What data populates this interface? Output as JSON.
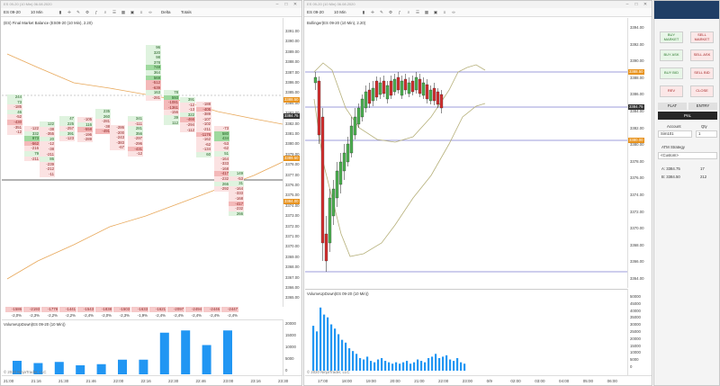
{
  "left_window": {
    "title": "ES 09-20 (10 Min)   06.08.2020",
    "instrument": "ES 09-20",
    "period": "10 Min",
    "toolbar_delta": "Delta",
    "toolbar_totals": "Totals",
    "indicator_label": "(ES09-20 (10 Min), 2.20)",
    "indicator_prefix": "(ES) Final Market Balance",
    "price_axis": [
      "3391.00",
      "3390.00",
      "3389.00",
      "3388.00",
      "3387.00",
      "3386.00",
      "3385.00",
      "3384.00",
      "3383.00",
      "3382.00",
      "3381.00",
      "3380.00",
      "3379.00",
      "3378.00",
      "3377.00",
      "3376.00",
      "3375.00",
      "3374.00",
      "3373.00",
      "3372.00",
      "3371.00",
      "3370.00",
      "3369.00",
      "3368.00",
      "3367.00",
      "3366.00",
      "3365.00"
    ],
    "price_tags": [
      {
        "text": "3388.50",
        "color": "#e8931e"
      },
      {
        "text": "3384.75",
        "color": "#333333"
      },
      {
        "text": "3389.50",
        "color": "#e8931e"
      },
      {
        "text": "3384.00",
        "color": "#e8931e"
      }
    ],
    "deltas": [
      "-1586",
      "-2193",
      "-1779",
      "-1441",
      "-1543",
      "-1838",
      "-1503",
      "-1633",
      "-1621",
      "-2097",
      "-2494",
      "-2446",
      "-2447"
    ],
    "delta_pct": [
      "-2,0%",
      "-2,3%",
      "-2,2%",
      "-2,2%",
      "-2,4%",
      "-2,0%",
      "-2,3%",
      "-1,9%",
      "-2,4%",
      "-2,4%",
      "-2,4%",
      "-2,4%",
      "-2,4%"
    ],
    "volume_label": "VolumeUpDown(ES 09-20 (10 Min))",
    "volume_axis": [
      "20000",
      "15000",
      "10000",
      "5000",
      "0"
    ],
    "volume_values": [
      6000,
      5000,
      5500,
      4000,
      4500,
      6500,
      6500,
      18500,
      19500,
      13000,
      19500,
      0,
      0
    ],
    "copyright": "© 2020 NinjaTrader, LLC",
    "time_axis": [
      "21:00",
      "21:16",
      "21:30",
      "21:46",
      "22:00",
      "22:16",
      "22:30",
      "22:46",
      "23:00",
      "23:16",
      "23:30"
    ]
  },
  "right_window": {
    "title": "ES 09-20 (10 Min)   06.08.2020",
    "instrument": "ES 09-20",
    "period": "10 Min",
    "indicator_label": "Bollinger(ES 09-20 (10 Min), 2.20)",
    "price_axis": [
      "3394.00",
      "3392.00",
      "3390.00",
      "3388.00",
      "3386.00",
      "3384.00",
      "3382.00",
      "3380.00",
      "3378.00",
      "3376.00",
      "3374.00",
      "3372.00",
      "3370.00",
      "3368.00",
      "3366.00",
      "3364.00"
    ],
    "price_tags": [
      {
        "text": "3388.50",
        "color": "#e8931e"
      },
      {
        "text": "3384.75",
        "color": "#333333"
      },
      {
        "text": "3380.00",
        "color": "#e8931e"
      }
    ],
    "volume_label": "VolumeUpDown(ES 09-20 (10 Min))",
    "volume_axis": [
      "50000",
      "45000",
      "40000",
      "35000",
      "30000",
      "25000",
      "20000",
      "15000",
      "10000",
      "5000",
      "0"
    ],
    "copyright": "© 2020 NinjaTrader, LLC",
    "time_axis": [
      "17:00",
      "18:00",
      "19:00",
      "20:00",
      "21:00",
      "22:00",
      "23:00",
      "0/9",
      "02:00",
      "03:00",
      "04:00",
      "05:00",
      "06:00"
    ]
  },
  "order_panel": {
    "buttons": [
      {
        "label": "BUY MARKET",
        "style": "green"
      },
      {
        "label": "SELL MARKET",
        "style": "red"
      },
      {
        "label": "BUY ASK",
        "style": "green"
      },
      {
        "label": "SELL ASK",
        "style": "red"
      },
      {
        "label": "BUY BID",
        "style": "green"
      },
      {
        "label": "SELL BID",
        "style": "red"
      },
      {
        "label": "REV",
        "style": "red"
      },
      {
        "label": "CLOSE",
        "style": "red"
      }
    ],
    "flat_label": "FLAT",
    "entry_label": "ENTRY",
    "pnl_label": "PnL",
    "account_label": "Account",
    "qty_label": "Qty",
    "account_value": "Sim101",
    "qty_value": "1",
    "atm_label": "ATM Strategy",
    "atm_value": "<Custom>",
    "ask_label": "A: 3384.75",
    "ask_size": "17",
    "bid_label": "B: 3384.50",
    "bid_size": "212"
  }
}
